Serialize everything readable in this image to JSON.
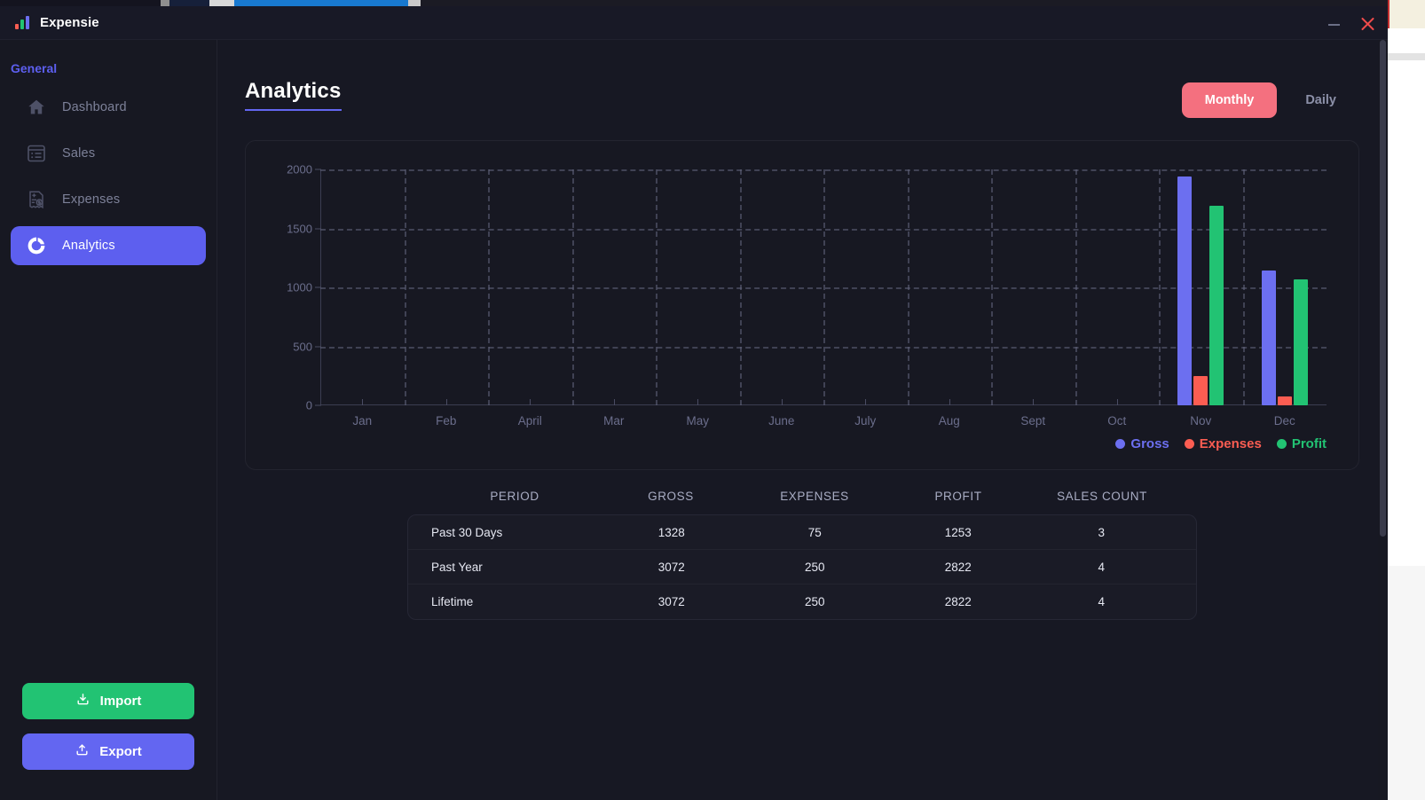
{
  "window": {
    "app_name": "Expensie",
    "logo_icon": "bar-chart-icon",
    "minimize_label": "minimize-icon",
    "close_label": "close-icon"
  },
  "sidebar": {
    "section_label": "General",
    "items": [
      {
        "label": "Dashboard",
        "icon": "home-icon",
        "active": false
      },
      {
        "label": "Sales",
        "icon": "list-icon",
        "active": false
      },
      {
        "label": "Expenses",
        "icon": "receipt-dollar-icon",
        "active": false
      },
      {
        "label": "Analytics",
        "icon": "donut-chart-icon",
        "active": true
      }
    ],
    "actions": [
      {
        "label": "Import",
        "icon": "download-icon",
        "color": "#22c373"
      },
      {
        "label": "Export",
        "icon": "upload-icon",
        "color": "#6366f1"
      }
    ]
  },
  "main": {
    "page_title": "Analytics",
    "period_toggle": {
      "options": [
        {
          "label": "Monthly",
          "active": true
        },
        {
          "label": "Daily",
          "active": false
        }
      ],
      "active_color": "#f4707f"
    }
  },
  "chart_data": {
    "type": "bar",
    "title": "",
    "xlabel": "",
    "ylabel": "",
    "ylim": [
      0,
      2000
    ],
    "yticks": [
      0,
      500,
      1000,
      1500,
      2000
    ],
    "grid": true,
    "legend_position": "bottom-right",
    "categories": [
      "Jan",
      "Feb",
      "April",
      "Mar",
      "May",
      "June",
      "July",
      "Aug",
      "Sept",
      "Oct",
      "Nov",
      "Dec"
    ],
    "series": [
      {
        "name": "Gross",
        "color": "#6c6ff0",
        "values": [
          0,
          0,
          0,
          0,
          0,
          0,
          0,
          0,
          0,
          0,
          1940,
          1140
        ]
      },
      {
        "name": "Expenses",
        "color": "#fb5d52",
        "values": [
          0,
          0,
          0,
          0,
          0,
          0,
          0,
          0,
          0,
          0,
          250,
          75
        ]
      },
      {
        "name": "Profit",
        "color": "#22c373",
        "values": [
          0,
          0,
          0,
          0,
          0,
          0,
          0,
          0,
          0,
          0,
          1690,
          1070
        ]
      }
    ]
  },
  "table": {
    "columns": [
      "PERIOD",
      "GROSS",
      "EXPENSES",
      "PROFIT",
      "SALES COUNT"
    ],
    "rows": [
      {
        "period": "Past 30 Days",
        "gross": "1328",
        "expenses": "75",
        "profit": "1253",
        "sales_count": "3"
      },
      {
        "period": "Past Year",
        "gross": "3072",
        "expenses": "250",
        "profit": "2822",
        "sales_count": "4"
      },
      {
        "period": "Lifetime",
        "gross": "3072",
        "expenses": "250",
        "profit": "2822",
        "sales_count": "4"
      }
    ]
  }
}
